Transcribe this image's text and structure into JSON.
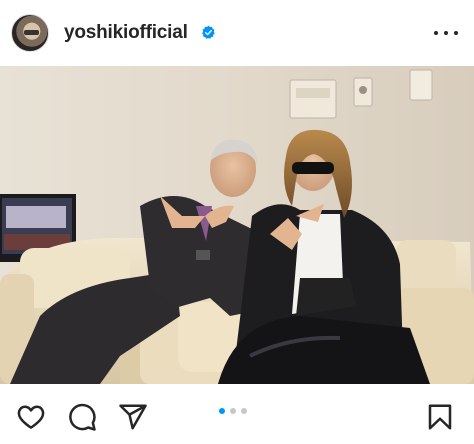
{
  "post": {
    "username": "yoshikiofficial",
    "verified": true,
    "more_icon": "more-horizontal-icon",
    "carousel": {
      "total": 3,
      "active": 1
    }
  },
  "actions": {
    "icons": [
      "heart-icon",
      "comment-icon",
      "share-icon",
      "bookmark-icon"
    ]
  },
  "colors": {
    "accent": "#0095f6",
    "text": "#262626",
    "dot_inactive": "#c7c7c7"
  }
}
